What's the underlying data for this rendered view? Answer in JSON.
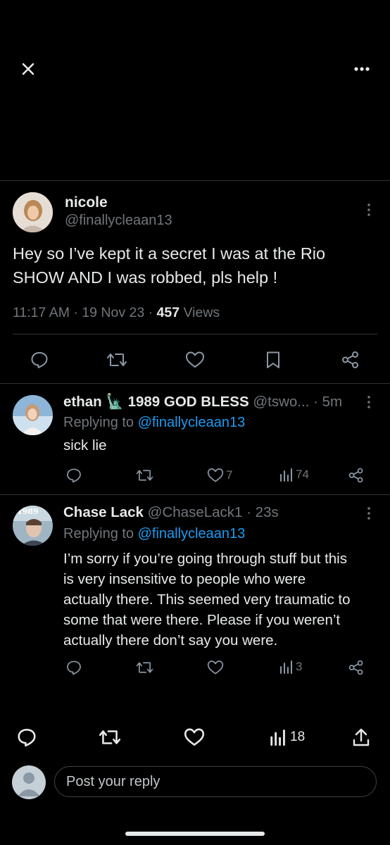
{
  "main_post": {
    "display_name": "nicole",
    "handle": "@finallycleaan13",
    "text_line1": "Hey so I’ve kept it a secret I was at the Rio",
    "text_line2": "SHOW AND I was robbed, pls help !",
    "time": "11:17 AM",
    "date": "19 Nov 23",
    "views_count": "457",
    "views_label": "Views",
    "sep": "·"
  },
  "replies": [
    {
      "display_name": "ethan 🗽 1989 GOD BLESS",
      "handle": "@tswo...",
      "time": "· 5m",
      "replying_prefix": "Replying to",
      "replying_handle": "@finallycleaan13",
      "text_lines": [
        "sick lie"
      ],
      "likes": "7",
      "views": "74"
    },
    {
      "display_name": "Chase Lack",
      "handle": "@ChaseLack1",
      "time": "· 23s",
      "replying_prefix": "Replying to",
      "replying_handle": "@finallycleaan13",
      "avatar_text": "1989",
      "text_lines": [
        "I’m sorry if you’re going through stuff but this",
        "is very insensitive to people who were",
        "actually there. This seemed very traumatic to",
        "some that were there. Please if you weren’t",
        "actually there don’t say you were."
      ],
      "likes": "",
      "views": "3"
    }
  ],
  "bottom_bar": {
    "views": "18"
  },
  "reply_input": {
    "placeholder": "Post your reply"
  },
  "colors": {
    "accent": "#1d9bf0",
    "muted": "#71767b",
    "background": "#000000"
  }
}
